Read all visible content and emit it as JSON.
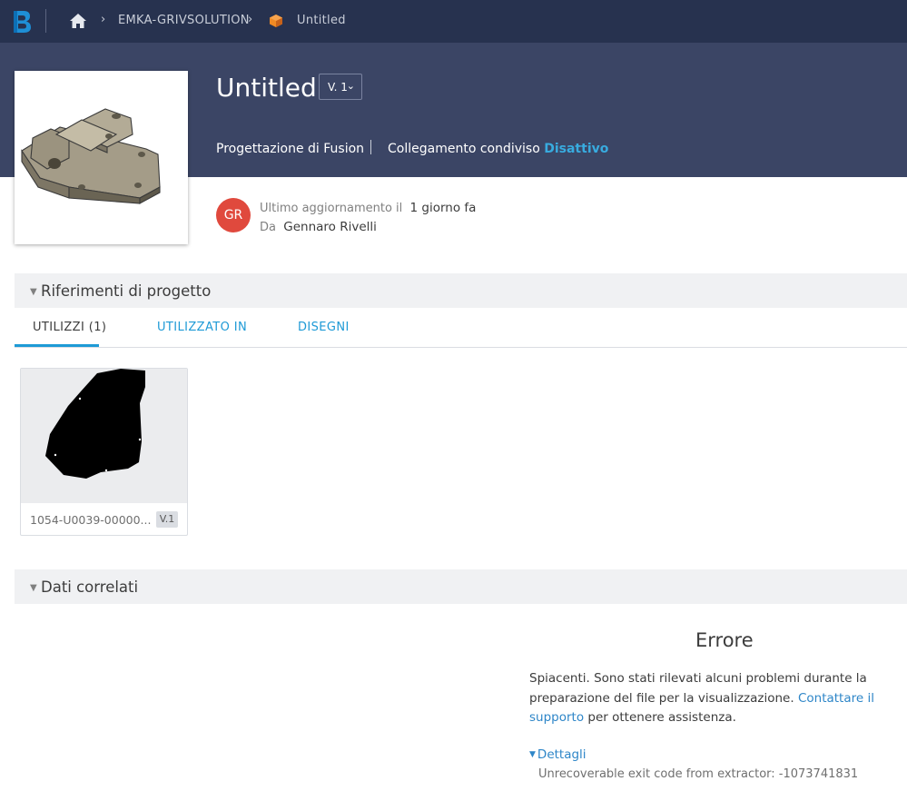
{
  "header": {
    "breadcrumb": {
      "project": "EMKA-GRIVSOLUTION",
      "file": "Untitled"
    }
  },
  "file": {
    "title": "Untitled",
    "version": "V. 1",
    "type_label": "Progettazione di Fusion",
    "shared_link_label": "Collegamento condiviso",
    "shared_link_status": "Disattivo",
    "avatar_initials": "GR",
    "updated_label": "Ultimo aggiornamento il",
    "updated_value": "1 giorno fa",
    "by_label": "Da",
    "by_value": "Gennaro Rivelli"
  },
  "references": {
    "section_title": "Riferimenti di progetto",
    "tabs": [
      {
        "label": "UTILIZZI (1)",
        "active": true
      },
      {
        "label": "UTILIZZATO IN",
        "active": false
      },
      {
        "label": "DISEGNI",
        "active": false
      }
    ],
    "items": [
      {
        "name": "1054-U0039-00000...",
        "version": "V.1"
      }
    ]
  },
  "related": {
    "section_title": "Dati correlati",
    "error": {
      "title": "Errore",
      "message_pre": "Spiacenti. Sono stati rilevati alcuni problemi durante la preparazione del file per la visualizzazione.",
      "link": "Contattare il supporto",
      "message_post": "per ottenere assistenza.",
      "details_label": "Dettagli",
      "details_text": "Unrecoverable exit code from extractor: -1073741831"
    }
  },
  "colors": {
    "topbar": "#27324f",
    "hero": "#3b4565",
    "accent": "#1e9ad6",
    "avatar": "#e0493d"
  },
  "icons": [
    "app-logo-icon",
    "home-icon",
    "chevron-right-icon",
    "fusion-cube-icon",
    "chevron-down-icon",
    "triangle-down-icon"
  ]
}
